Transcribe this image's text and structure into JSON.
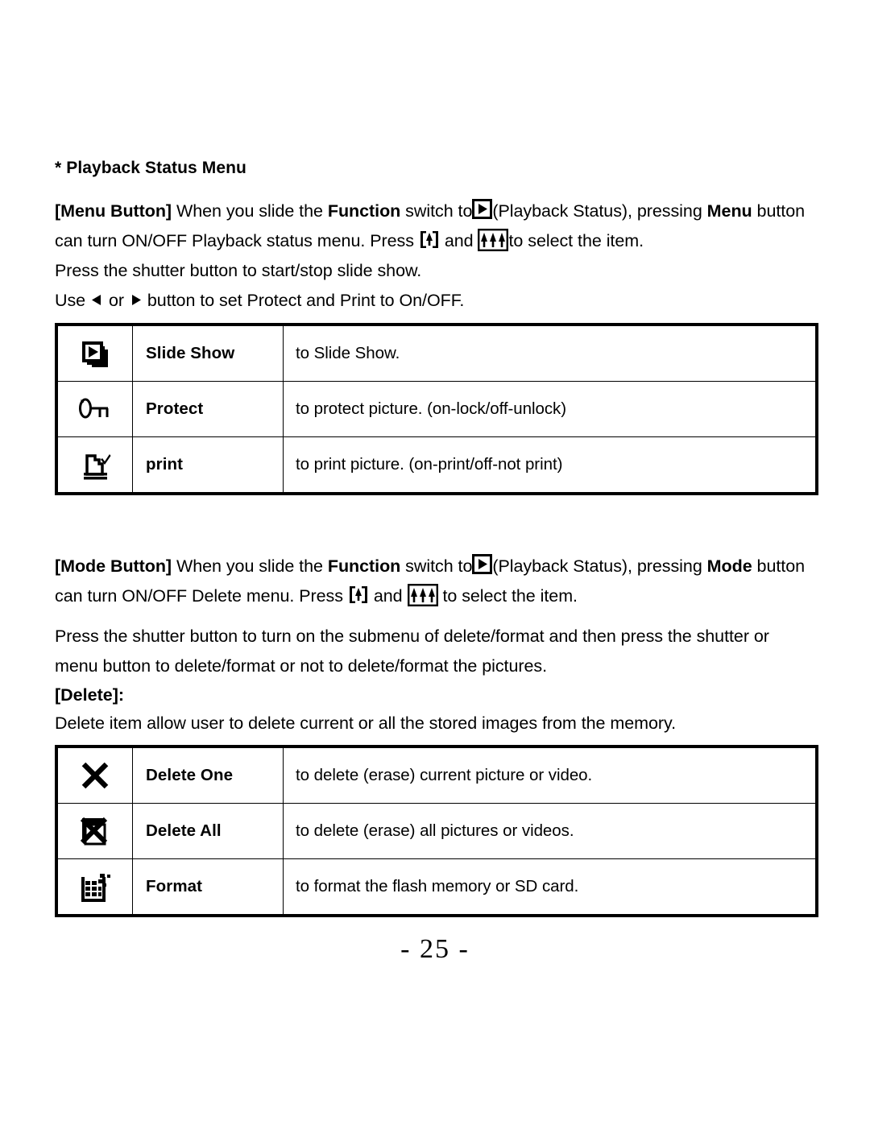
{
  "document": {
    "page_number": "- 25 -",
    "sections": [
      {
        "heading": "* Playback Status Menu"
      }
    ]
  },
  "menu_section": {
    "heading": "* Playback Status Menu",
    "intro": {
      "label": "[Menu Button]",
      "text_1": "When you slide the",
      "bold_1": "Function",
      "text_2": "switch to",
      "icon_1": "play-button-icon",
      "text_3": "(Playback Status), pressing",
      "bold_2": "Menu",
      "text_4": "button can turn ON/OFF Playback status menu. Press",
      "icon_2": "single-tree-bracket-icon",
      "text_5": "and",
      "icon_3": "triple-tree-box-icon",
      "text_6": "to select the item."
    },
    "line_shutter": "Press the shutter button to start/stop slide show.",
    "line_use": {
      "text_1": "Use",
      "icon_left": "left-triangle-icon",
      "text_2": "or",
      "icon_right": "right-triangle-icon",
      "text_3": "button to set Protect and Print to On/OFF."
    },
    "table": {
      "rows": [
        {
          "icon": "slide-show-icon",
          "name": "Slide Show",
          "description": "to Slide Show."
        },
        {
          "icon": "key-protect-icon",
          "name": "Protect",
          "description": "to protect picture. (on-lock/off-unlock)"
        },
        {
          "icon": "printer-check-icon",
          "name": "print",
          "description": "to print picture. (on-print/off-not print)"
        }
      ]
    }
  },
  "mode_section": {
    "intro": {
      "label": "[Mode Button]",
      "text_1": "When you slide the",
      "bold_1": "Function",
      "text_2": "switch to",
      "icon_1": "play-button-icon",
      "text_3": "(Playback Status), pressing",
      "bold_2": "Mode",
      "text_4": "button can turn ON/OFF Delete menu. Press",
      "icon_2": "single-tree-bracket-icon",
      "text_5": "and",
      "icon_3": "triple-tree-box-icon",
      "text_6": "to select the item."
    },
    "line_shutter_1": "Press the shutter button to turn on the submenu of delete/format and then press the shutter or",
    "line_shutter_2": "menu button to delete/format or not to delete/format the pictures.",
    "delete_heading": "[Delete]:",
    "delete_desc": "Delete item allow user to delete current or all the stored images from the memory.",
    "table": {
      "rows": [
        {
          "icon": "delete-one-x-icon",
          "name": "Delete One",
          "description": "to delete (erase) current picture or video."
        },
        {
          "icon": "delete-all-icon",
          "name": "Delete All",
          "description": "to delete (erase) all pictures or videos."
        },
        {
          "icon": "format-card-icon",
          "name": "Format",
          "description": "to format the flash memory or SD card."
        }
      ]
    }
  },
  "colors": {
    "text": "#000000",
    "background": "#ffffff",
    "border": "#000000"
  }
}
